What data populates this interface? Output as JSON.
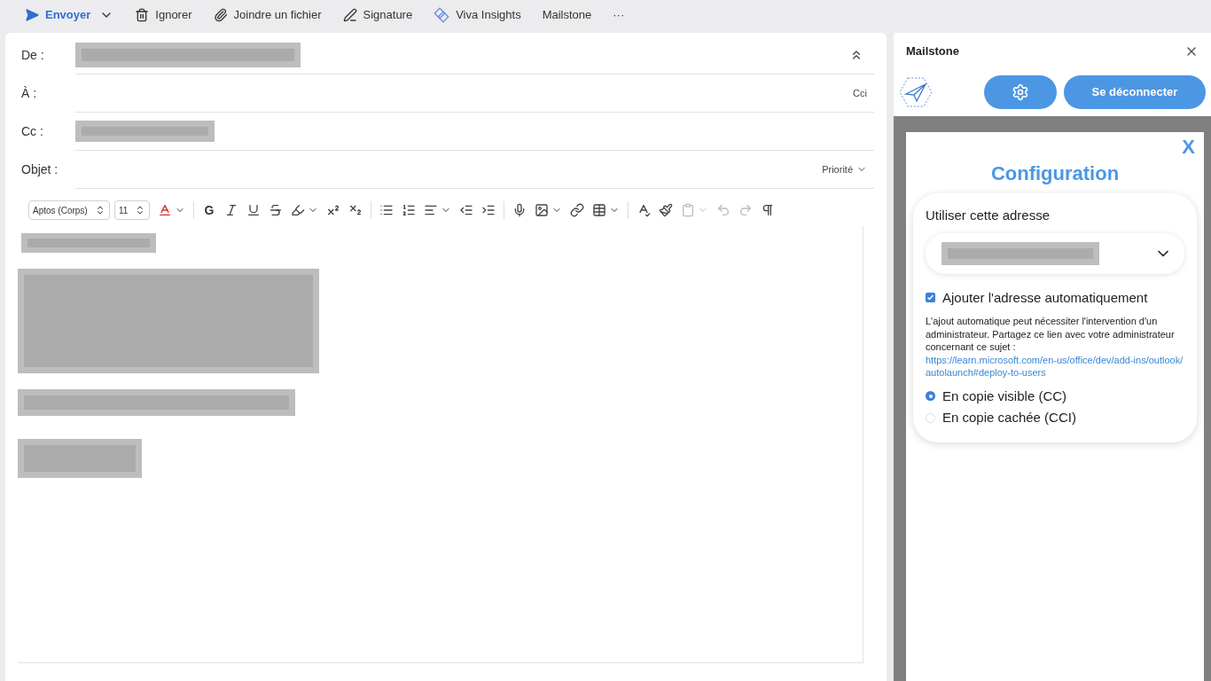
{
  "command_bar": [
    {
      "kind": "send",
      "label": "Envoyer"
    },
    {
      "kind": "discard",
      "label": "Ignorer"
    },
    {
      "kind": "attach",
      "label": "Joindre un fichier"
    },
    {
      "kind": "signature",
      "label": "Signature"
    },
    {
      "kind": "insights",
      "label": "Viva Insights"
    },
    {
      "kind": "plain",
      "label": "Mailstone"
    },
    {
      "kind": "plain",
      "label": "···"
    }
  ],
  "compose": {
    "fields": [
      {
        "label": "De :",
        "redacted": true
      },
      {
        "label": "À :",
        "redacted": false,
        "action": "Cci"
      },
      {
        "label": "Cc :",
        "redacted": true
      },
      {
        "label": "Objet :",
        "redacted": false,
        "action": "Priorité"
      }
    ],
    "format_toolbar": {
      "font": "Aptos (Corps)",
      "size": "11",
      "bold": "G"
    }
  },
  "pane": {
    "title": "Mailstone",
    "logout": "Se déconnecter",
    "dialog": {
      "close": "X",
      "title": "Configuration",
      "address_label": "Utiliser cette adresse",
      "auto_add": {
        "label": "Ajouter l'adresse automatiquement",
        "checked": true
      },
      "note": "L'ajout automatique peut nécessiter l'intervention d'un administrateur. Partagez ce lien avec votre administrateur concernant ce sujet :",
      "link": "https://learn.microsoft.com/en-us/office/dev/add-ins/outlook/autolaunch#deploy-to-users",
      "options": [
        {
          "label": "En copie visible (CC)",
          "selected": true
        },
        {
          "label": "En copie cachée (CCI)",
          "selected": false
        }
      ]
    }
  }
}
